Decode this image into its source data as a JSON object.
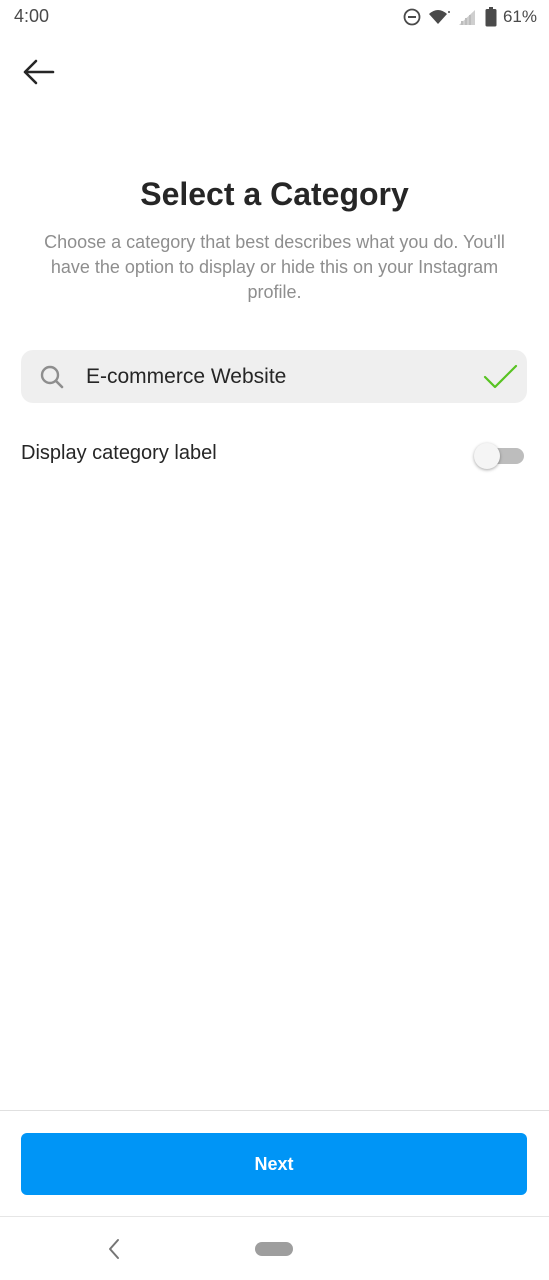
{
  "status_bar": {
    "time": "4:00",
    "battery": "61%",
    "icons": [
      "do-not-disturb-icon",
      "wifi-icon",
      "signal-icon",
      "battery-icon"
    ]
  },
  "header": {
    "back_icon": "arrow-left-icon"
  },
  "main": {
    "title": "Select a Category",
    "description": "Choose a category that best describes what you do. You'll have the option to display or hide this on your Instagram profile.",
    "search": {
      "icon": "search-icon",
      "value": "E-commerce Website",
      "valid_icon": "checkmark-icon"
    },
    "toggle": {
      "label": "Display category label",
      "enabled": false
    }
  },
  "footer": {
    "next_label": "Next"
  },
  "colors": {
    "primary_button": "#0095f6",
    "check": "#58c322",
    "field_bg": "#efefef",
    "muted_text": "#8e8e8e"
  },
  "nav_bar": {
    "icons": [
      "nav-back-icon",
      "nav-home-pill"
    ]
  }
}
